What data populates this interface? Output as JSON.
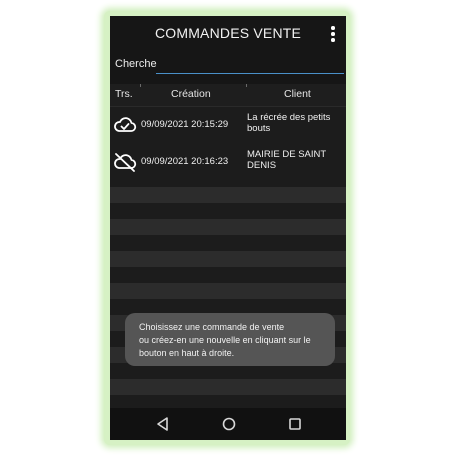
{
  "app": {
    "title": "COMMANDES VENTE",
    "menu_icon": "more-vert-icon"
  },
  "search": {
    "label": "Cherche",
    "value": "",
    "placeholder": ""
  },
  "table": {
    "columns": [
      "Trs.",
      "Création",
      "Client"
    ],
    "rows": [
      {
        "sync_icon": "cloud-check-icon",
        "created": "09/09/2021 20:15:29",
        "client_line1": "La récrée des petits",
        "client_line2": "bouts"
      },
      {
        "sync_icon": "cloud-off-icon",
        "created": "09/09/2021 20:16:23",
        "client_line1": "MAIRIE DE SAINT",
        "client_line2": "DENIS"
      }
    ]
  },
  "toast": {
    "line1": "Choisissez une commande de vente",
    "line2": "ou créez-en une nouvelle en cliquant sur le",
    "line3": "bouton en haut à droite."
  },
  "navbar": {
    "back_icon": "back-triangle-icon",
    "home_icon": "home-circle-icon",
    "recent_icon": "recent-apps-square-icon"
  },
  "colors": {
    "background": "#1a1a1a",
    "row_alt": "#2c2c2c",
    "accent_underline": "#4a90c9",
    "glow": "#d6f1c4",
    "toast": "#555555"
  }
}
